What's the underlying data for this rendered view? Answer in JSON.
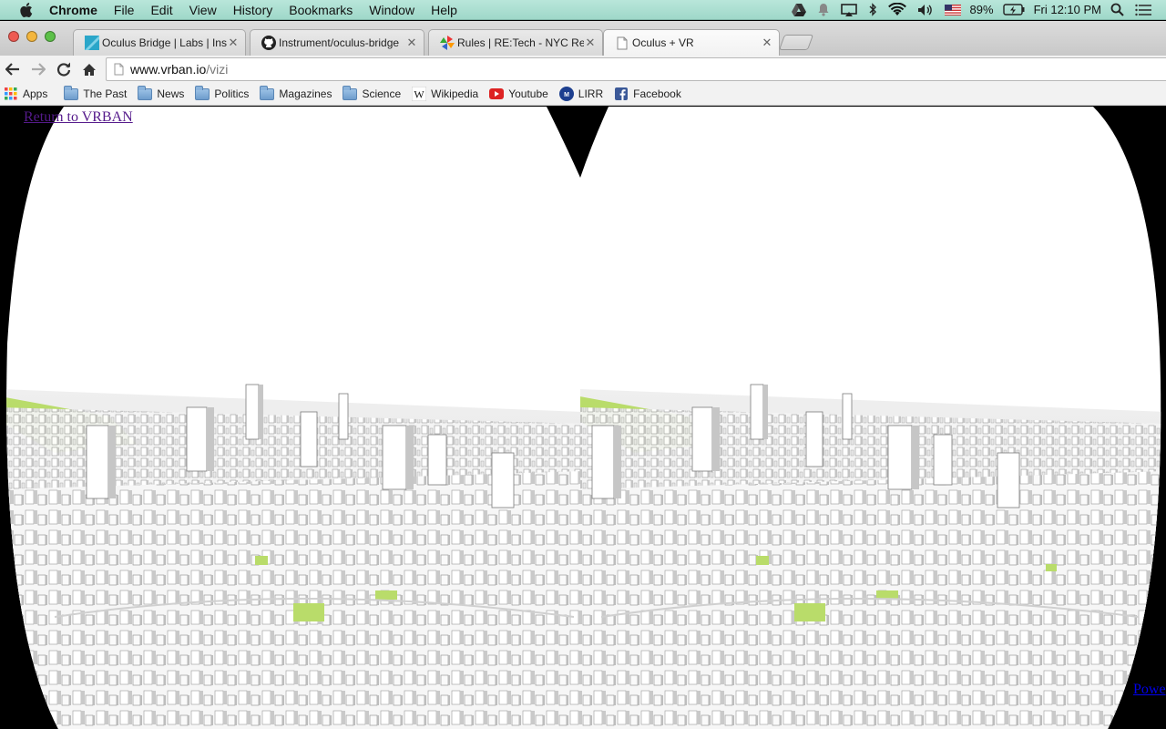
{
  "menubar": {
    "app_name": "Chrome",
    "menus": [
      "File",
      "Edit",
      "View",
      "History",
      "Bookmarks",
      "Window",
      "Help"
    ],
    "battery": "89%",
    "clock": "Fri 12:10 PM"
  },
  "tabs": [
    {
      "title": "Oculus Bridge | Labs | Instrument",
      "icon": "instrument-logo-icon",
      "active": false
    },
    {
      "title": "Instrument/oculus-bridge",
      "icon": "github-icon",
      "active": false
    },
    {
      "title": "Rules | RE:Tech - NYC Real Estate",
      "icon": "retech-logo-icon",
      "active": false
    },
    {
      "title": "Oculus + VR",
      "icon": "page-icon",
      "active": true
    }
  ],
  "omnibox": {
    "host": "www.vrban.io",
    "path": "/vizi"
  },
  "bookmarks": [
    {
      "label": "Apps",
      "icon": "apps-grid-icon"
    },
    {
      "label": "The Past",
      "icon": "folder-icon"
    },
    {
      "label": "News",
      "icon": "folder-icon"
    },
    {
      "label": "Politics",
      "icon": "folder-icon"
    },
    {
      "label": "Magazines",
      "icon": "folder-icon"
    },
    {
      "label": "Science",
      "icon": "folder-icon"
    },
    {
      "label": "Wikipedia",
      "icon": "wikipedia-icon"
    },
    {
      "label": "Youtube",
      "icon": "youtube-icon"
    },
    {
      "label": "LIRR",
      "icon": "mta-icon"
    },
    {
      "label": "Facebook",
      "icon": "facebook-icon"
    }
  ],
  "page": {
    "return_link": "Return to VRBAN",
    "powered_link": "Powe"
  },
  "colors": {
    "menubar_bg": "#a9ddd0",
    "park_green": "#b9dc6a",
    "building_face": "#f4f4f4",
    "building_shade": "#c8c8c8"
  }
}
